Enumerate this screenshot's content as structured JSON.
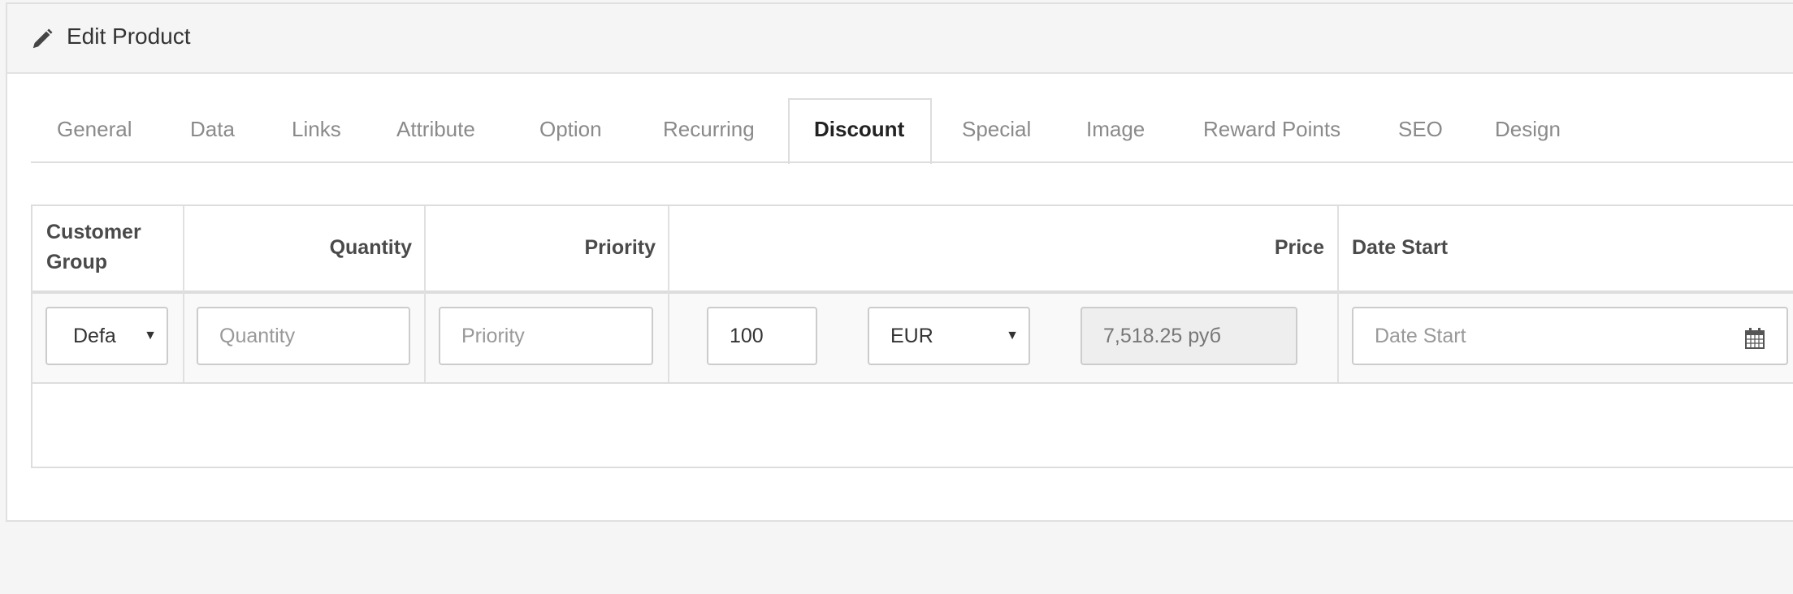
{
  "panel": {
    "title": "Edit Product",
    "icon": "pencil-icon"
  },
  "tabs": [
    {
      "label": "General"
    },
    {
      "label": "Data"
    },
    {
      "label": "Links"
    },
    {
      "label": "Attribute"
    },
    {
      "label": "Option"
    },
    {
      "label": "Recurring"
    },
    {
      "label": "Discount",
      "active": true
    },
    {
      "label": "Special"
    },
    {
      "label": "Image"
    },
    {
      "label": "Reward Points"
    },
    {
      "label": "SEO"
    },
    {
      "label": "Design"
    }
  ],
  "table": {
    "headers": {
      "customer_group": "Customer Group",
      "quantity": "Quantity",
      "priority": "Priority",
      "price": "Price",
      "date_start": "Date Start"
    },
    "row": {
      "customer_group": "Defa",
      "quantity_placeholder": "Quantity",
      "priority_placeholder": "Priority",
      "price_value": "100",
      "currency": "EUR",
      "converted_price": "7,518.25 руб",
      "date_start_placeholder": "Date Start",
      "calendar_icon": "calendar-icon"
    }
  }
}
